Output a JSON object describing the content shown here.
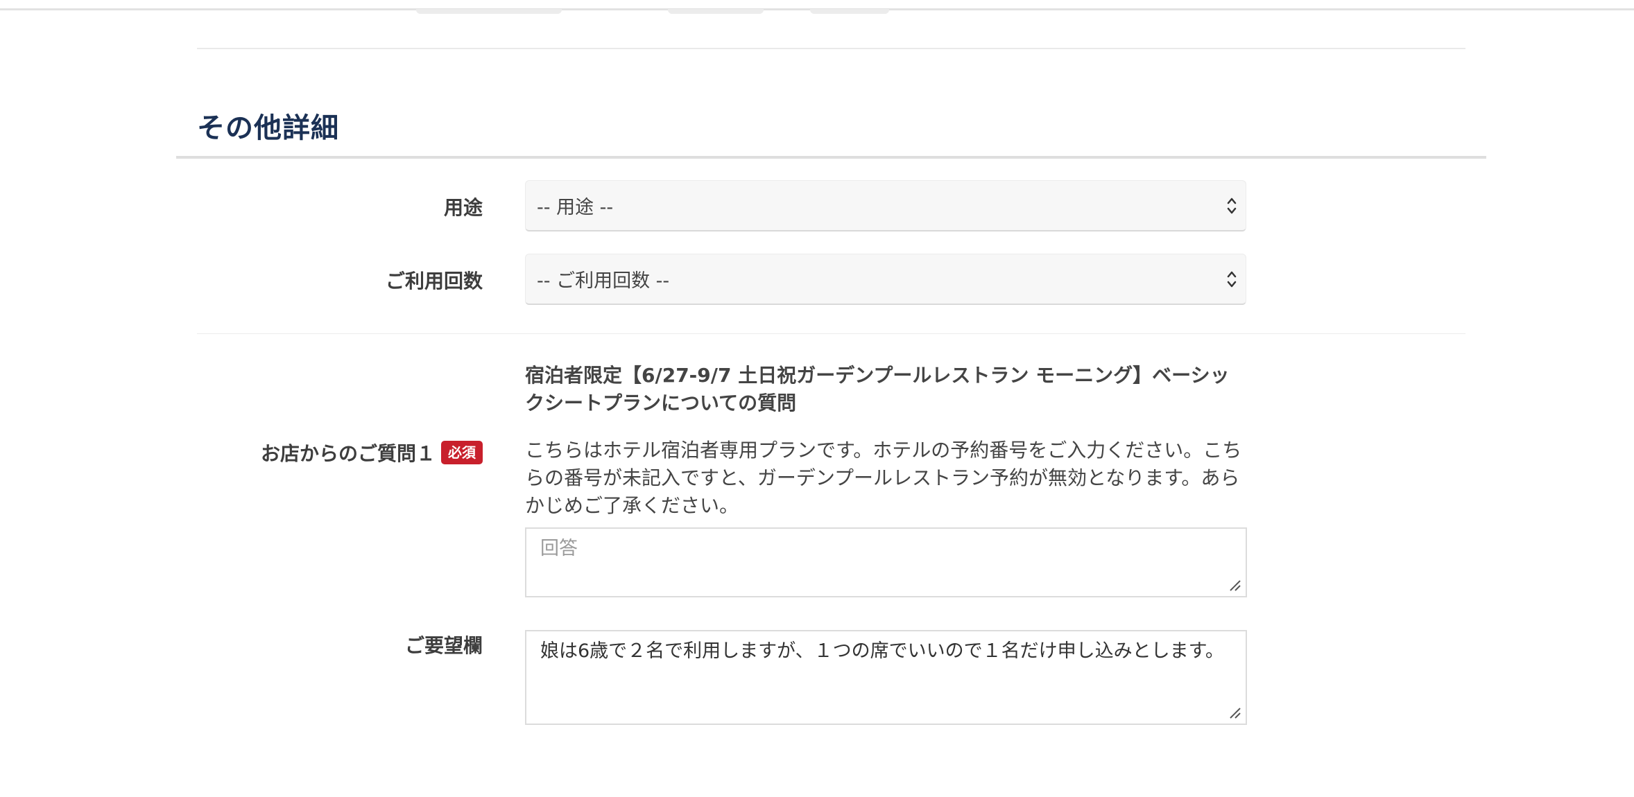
{
  "section": {
    "title": "その他詳細"
  },
  "fields": {
    "usage": {
      "label": "用途",
      "selected": "-- 用途 --"
    },
    "visit_count": {
      "label": "ご利用回数",
      "selected": "-- ご利用回数 --"
    },
    "question1": {
      "label": "お店からのご質問１",
      "required_badge": "必須",
      "title": "宿泊者限定【6/27-9/7 土日祝ガーデンプールレストラン モーニング】ベーシックシートプランについての質問",
      "description": "こちらはホテル宿泊者専用プランです。ホテルの予約番号をご入力ください。こちらの番号が未記入ですと、ガーデンプールレストラン予約が無効となります。あらかじめご了承ください。",
      "answer_placeholder": "回答"
    },
    "request": {
      "label": "ご要望欄",
      "value": "娘は6歳で２名で利用しますが、１つの席でいいので１名だけ申し込みとします。"
    }
  },
  "colors": {
    "heading": "#1b3155",
    "required": "#c8202c",
    "select_bg": "#f7f7f7"
  }
}
